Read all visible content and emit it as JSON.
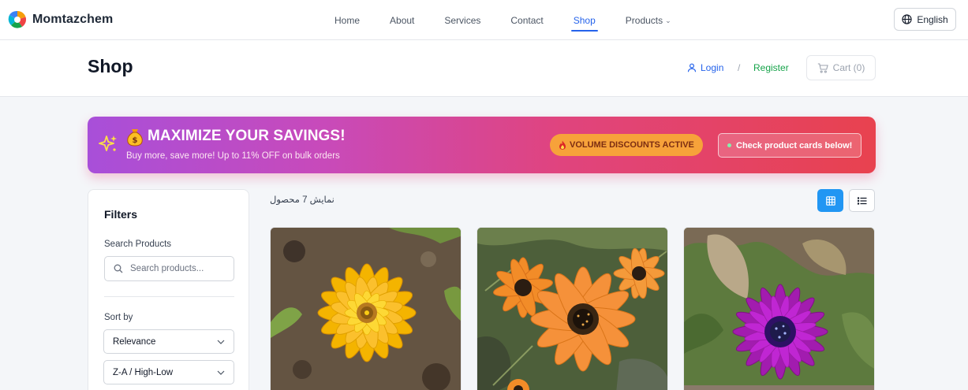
{
  "brand": {
    "name": "Momtazchem"
  },
  "nav": {
    "items": [
      {
        "label": "Home"
      },
      {
        "label": "About"
      },
      {
        "label": "Services"
      },
      {
        "label": "Contact"
      },
      {
        "label": "Shop",
        "active": true
      },
      {
        "label": "Products",
        "has_dropdown": true
      }
    ]
  },
  "language": {
    "label": "English",
    "icon": "globe-icon"
  },
  "page": {
    "title": "Shop"
  },
  "account": {
    "login_label": "Login",
    "separator": "/",
    "register_label": "Register",
    "cart_label": "Cart (0)"
  },
  "promo": {
    "title": "MAXIMIZE YOUR SAVINGS!",
    "subtitle": "Buy more, save more! Up to 11% OFF on bulk orders",
    "badge_label": "VOLUME DISCOUNTS ACTIVE",
    "cta_label": "Check product cards below!",
    "colors": {
      "gradient_start": "#a84fd9",
      "gradient_end": "#e8424f",
      "badge_bg": "#f7a23a"
    }
  },
  "filters": {
    "title": "Filters",
    "search_label": "Search Products",
    "search_placeholder": "Search products...",
    "search_value": "",
    "sort_label": "Sort by",
    "sort_value": "Relevance",
    "order_value": "Z-A / High-Low"
  },
  "results": {
    "count_text": "نمایش 7 محصول",
    "view_mode": "grid",
    "accent": "#2196f3"
  },
  "products": [
    {
      "image_icon": "yellow-zinnia-photo"
    },
    {
      "image_icon": "orange-daisy-photo"
    },
    {
      "image_icon": "purple-daisy-photo"
    }
  ]
}
